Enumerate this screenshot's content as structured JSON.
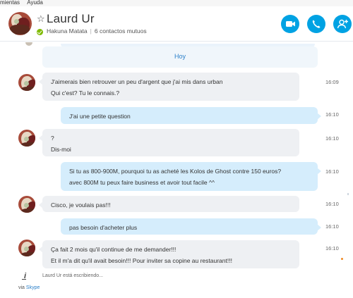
{
  "menu": [
    "mientas",
    "Ayuda"
  ],
  "contact": {
    "name": "Laurd Ur",
    "mood": "Hakuna Matata",
    "mutual": "6 contactos mutuos"
  },
  "chat": {
    "day_label": "Hoy",
    "messages": [
      {
        "dir": "in",
        "lines": [
          "J'aimerais bien retrouver un peu d'argent que j'ai mis dans urban",
          "Qui c'est? Tu le connais.?"
        ],
        "time": "16:09"
      },
      {
        "dir": "out",
        "lines": [
          "J'ai une petite question"
        ],
        "time": "16:10"
      },
      {
        "dir": "in",
        "lines": [
          "?",
          "Dis-moi"
        ],
        "time": "16:10"
      },
      {
        "dir": "out",
        "lines": [
          "Si tu as 800-900M, pourquoi tu as acheté les Kolos de Ghost contre 150 euros?",
          "avec 800M tu peux faire business et avoir tout facile ^^"
        ],
        "time": "16:10"
      },
      {
        "dir": "in",
        "lines": [
          "Cisco, je voulais pas!!!"
        ],
        "time": "16:10"
      },
      {
        "dir": "out",
        "lines": [
          "pas besoin d'acheter plus"
        ],
        "time": "16:10"
      },
      {
        "dir": "in",
        "lines": [
          "Ça fait 2 mois qu'il continue de me demander!!!",
          "Et il m'a dit qu'il avait besoin!!! Pour inviter sa copine au restaurant!!!"
        ],
        "time": "16:10"
      }
    ],
    "typing": "Laurd Ur está escribiendo...",
    "via_prefix": "via",
    "via_link": "Skype"
  },
  "icons": {
    "favorite": "star-icon",
    "presence": "online-check-icon",
    "video": "video-camera-icon",
    "call": "phone-icon",
    "add": "add-person-icon",
    "typing": "typing-pen-icon"
  },
  "colors": {
    "accent": "#00a2e3",
    "outgoing_bubble": "#d5edfc",
    "incoming_bubble": "#eef0f3",
    "presence_online": "#7fba00",
    "link": "#2a7fc9"
  }
}
